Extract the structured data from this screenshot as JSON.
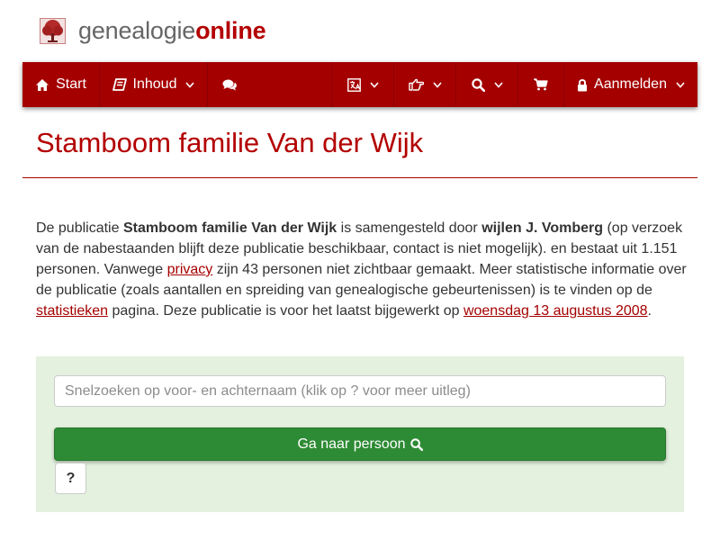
{
  "brand": {
    "name_part1": "genealogie",
    "name_part2": "online",
    "logo_icon": "tree-logo-icon"
  },
  "colors": {
    "brand_red": "#a50000",
    "title_red": "#b30000",
    "panel_green": "#e3f1de",
    "button_green": "#2e8b35"
  },
  "nav": {
    "start": {
      "label": "Start",
      "icon": "home-icon"
    },
    "inhoud": {
      "label": "Inhoud",
      "icon": "book-icon"
    },
    "comments": {
      "icon": "comments-icon"
    },
    "language": {
      "icon": "language-icon"
    },
    "share": {
      "icon": "hand-point-right-icon"
    },
    "search": {
      "icon": "search-icon"
    },
    "cart": {
      "icon": "cart-icon"
    },
    "login": {
      "label": "Aanmelden",
      "icon": "lock-icon"
    }
  },
  "page": {
    "title": "Stamboom familie Van der Wijk",
    "intro": {
      "t1": "De publicatie ",
      "pub_name": "Stamboom familie Van der Wijk",
      "t2": " is samengesteld door ",
      "author": "wijlen J. Vomberg",
      "t3": " (op verzoek van de nabestaanden blijft deze publicatie beschikbaar, contact is niet mogelijk). en bestaat uit 1.151 personen. Vanwege ",
      "privacy_link": "privacy",
      "t4": " zijn 43 personen niet zichtbaar gemaakt. Meer statistische informatie over de publicatie (zoals aantallen en spreiding van genealogische gebeurtenissen) is te vinden op de ",
      "stats_link": "statistieken",
      "t5": " pagina. Deze publicatie is voor het laatst bijgewerkt op ",
      "date_link": "woensdag 13 augustus 2008",
      "t6": "."
    }
  },
  "search": {
    "placeholder": "Snelzoeken op voor- en achternaam (klik op ? voor meer uitleg)",
    "go_label": "Ga naar persoon",
    "help_label": "?"
  }
}
